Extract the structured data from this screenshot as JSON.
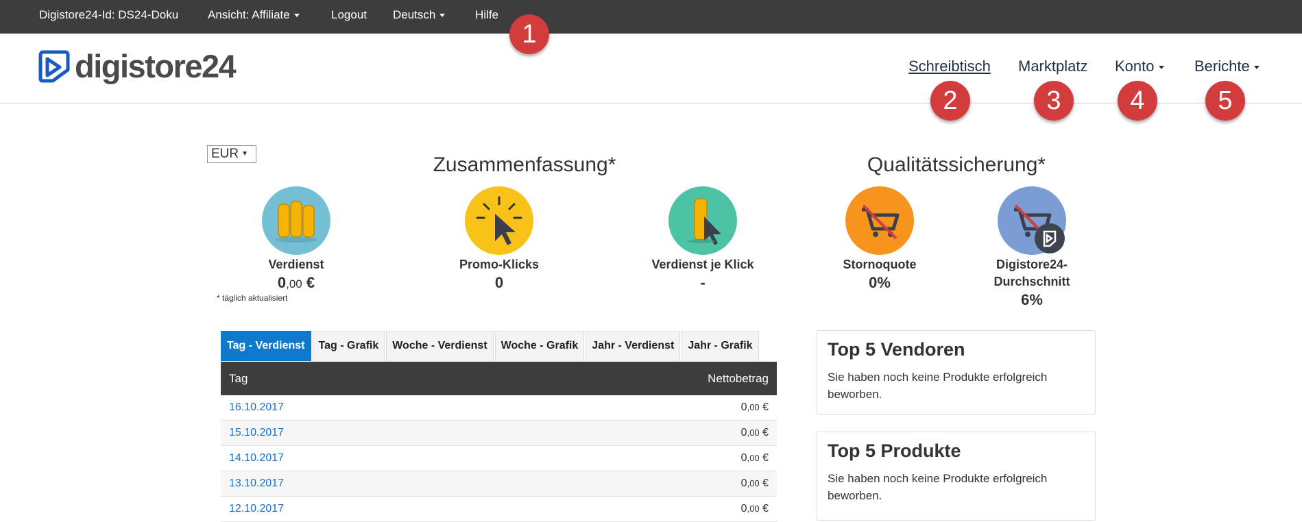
{
  "topbar": {
    "account_id": "Digistore24-Id: DS24-Doku",
    "view": "Ansicht: Affiliate",
    "logout": "Logout",
    "language": "Deutsch",
    "help": "Hilfe"
  },
  "header": {
    "logo_text": "digistore24",
    "nav": [
      "Schreibtisch",
      "Marktplatz",
      "Konto",
      "Berichte"
    ]
  },
  "badges": [
    "1",
    "2",
    "3",
    "4",
    "5"
  ],
  "currency": "EUR",
  "summary": {
    "title": "Zusammenfassung*",
    "earnings_label": "Verdienst",
    "earnings_whole": "0",
    "earnings_cents": ",00",
    "earnings_currency": " €",
    "clicks_label": "Promo-Klicks",
    "clicks_value": "0",
    "per_click_label": "Verdienst je Klick",
    "per_click_value": "-",
    "note": "* täglich aktualisiert"
  },
  "quality": {
    "title": "Qualitätssicherung*",
    "cancel_label": "Stornoquote",
    "cancel_value": "0%",
    "avg_label_1": "Digistore24-",
    "avg_label_2": "Durchschnitt",
    "avg_value": "6%"
  },
  "tabs": [
    "Tag - Verdienst",
    "Tag - Grafik",
    "Woche - Verdienst",
    "Woche - Grafik",
    "Jahr - Verdienst",
    "Jahr - Grafik"
  ],
  "table": {
    "col_day": "Tag",
    "col_net": "Nettobetrag",
    "rows": [
      {
        "date": "16.10.2017",
        "whole": "0",
        "cents": ",00",
        "cur": " €"
      },
      {
        "date": "15.10.2017",
        "whole": "0",
        "cents": ",00",
        "cur": " €"
      },
      {
        "date": "14.10.2017",
        "whole": "0",
        "cents": ",00",
        "cur": " €"
      },
      {
        "date": "13.10.2017",
        "whole": "0",
        "cents": ",00",
        "cur": " €"
      },
      {
        "date": "12.10.2017",
        "whole": "0",
        "cents": ",00",
        "cur": " €"
      }
    ]
  },
  "top_vendors": {
    "title": "Top 5 Vendoren",
    "text": "Sie haben noch keine Produkte erfolgreich beworben."
  },
  "top_products": {
    "title": "Top 5 Produkte",
    "text": "Sie haben noch keine Produkte erfolgreich beworben."
  },
  "colors": {
    "topbar": "#3d3d3d",
    "badge": "#d23c3c",
    "tab_active": "#0f7acc",
    "link": "#1a73c8"
  }
}
